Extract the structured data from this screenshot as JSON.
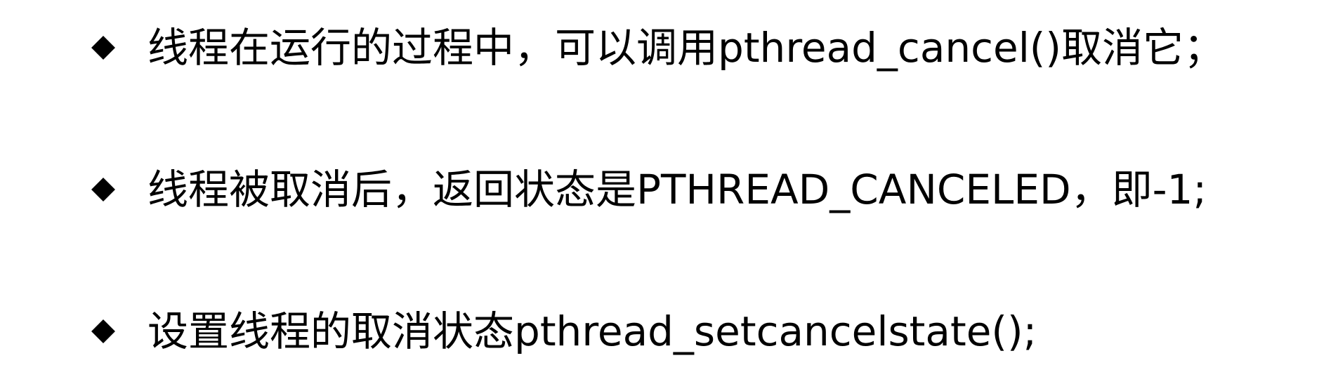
{
  "bullets": [
    {
      "text": "线程在运行的过程中，可以调用pthread_cancel()取消它；",
      "icon": "diamond-bullet-icon"
    },
    {
      "text": "线程被取消后，返回状态是PTHREAD_CANCELED，即-1;",
      "icon": "diamond-bullet-icon"
    },
    {
      "text": "设置线程的取消状态pthread_setcancelstate();",
      "icon": "diamond-bullet-icon"
    }
  ],
  "colors": {
    "background": "#ffffff",
    "text": "#000000"
  }
}
